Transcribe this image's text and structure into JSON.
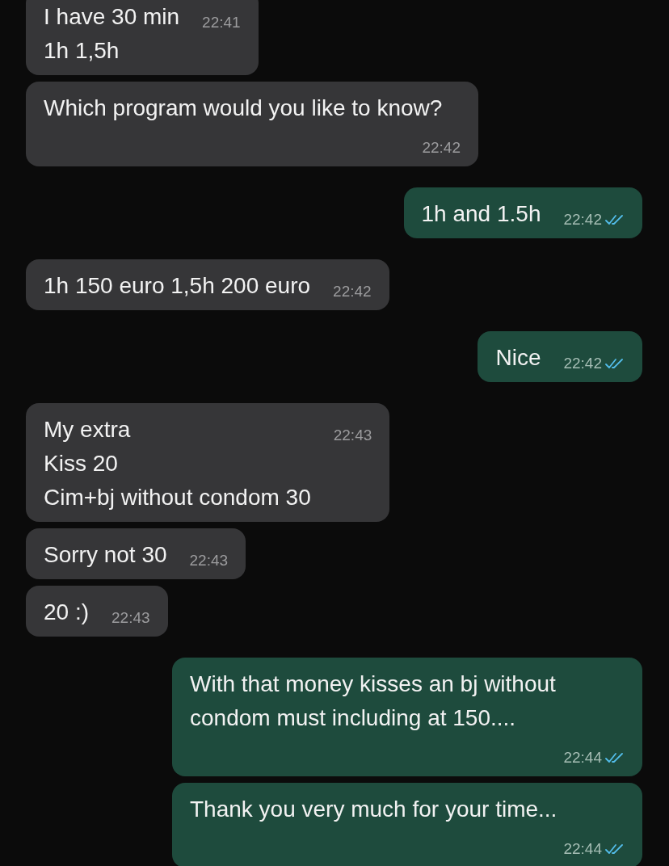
{
  "messages": [
    {
      "kind": "incoming",
      "lines": [
        "I have 30 min",
        "1h 1,5h"
      ],
      "time": "22:41"
    },
    {
      "kind": "incoming",
      "lines": [
        "Which program would you like to know?"
      ],
      "time": "22:42"
    },
    {
      "kind": "outgoing",
      "lines": [
        "1h and 1.5h"
      ],
      "time": "22:42",
      "read": true
    },
    {
      "kind": "incoming",
      "lines": [
        "1h 150 euro 1,5h 200 euro"
      ],
      "time": "22:42"
    },
    {
      "kind": "outgoing",
      "lines": [
        "Nice"
      ],
      "time": "22:42",
      "read": true
    },
    {
      "kind": "incoming",
      "lines": [
        "My extra",
        "Kiss 20",
        "Cim+bj without condom 30"
      ],
      "time": "22:43"
    },
    {
      "kind": "incoming",
      "lines": [
        "Sorry not 30"
      ],
      "time": "22:43"
    },
    {
      "kind": "incoming",
      "lines": [
        "20 :)"
      ],
      "time": "22:43"
    },
    {
      "kind": "outgoing",
      "lines": [
        "With that money kisses an bj without",
        "condom must including at 150...."
      ],
      "time": "22:44",
      "read": true
    },
    {
      "kind": "outgoing",
      "lines": [
        "Thank you very much for your time..."
      ],
      "time": "22:44",
      "read": true
    }
  ]
}
